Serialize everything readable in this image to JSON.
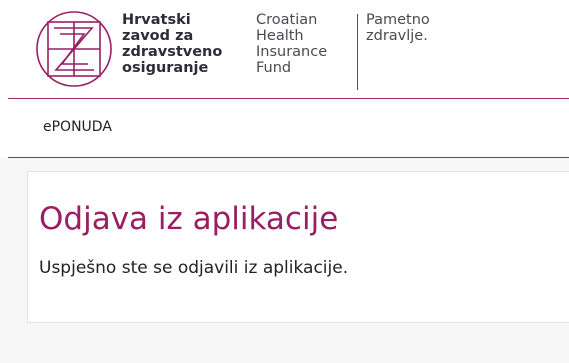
{
  "header": {
    "logo_icon": "hzzo-z-logo-icon",
    "org_name_hr": [
      "Hrvatski",
      "zavod za",
      "zdravstveno",
      "osiguranje"
    ],
    "org_name_en": [
      "Croatian",
      "Health",
      "Insurance",
      "Fund"
    ],
    "tagline": [
      "Pametno",
      "zdravlje."
    ]
  },
  "nav": {
    "items": [
      {
        "label": "ePONUDA"
      }
    ]
  },
  "main": {
    "title": "Odjava iz aplikacije",
    "message": "Uspješno ste se odjavili iz aplikacije."
  },
  "colors": {
    "brand": "#9b1d63",
    "rule": "#9c2b6a",
    "background": "#f7f7f7"
  }
}
